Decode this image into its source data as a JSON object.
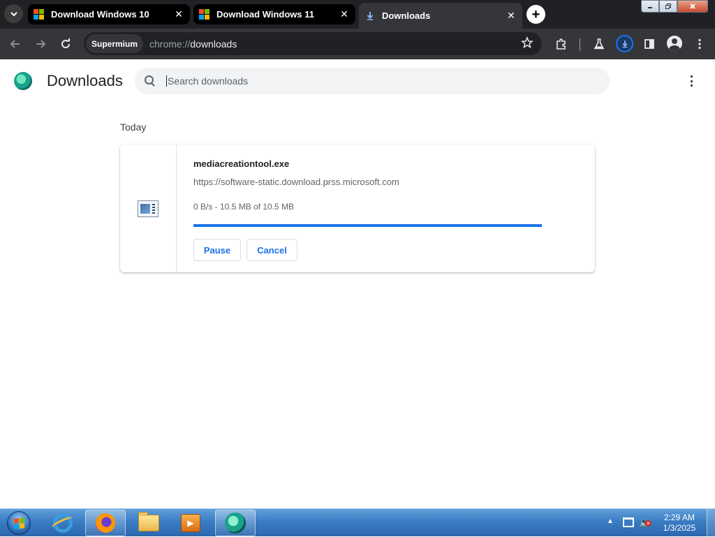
{
  "browser": {
    "tabs": [
      {
        "label": "Download Windows 10",
        "favicon": "microsoft-logo-icon",
        "active": false
      },
      {
        "label": "Download Windows 11",
        "favicon": "microsoft-logo-icon",
        "active": false
      },
      {
        "label": "Downloads",
        "favicon": "download-icon",
        "active": true
      }
    ],
    "tab_close_glyph": "✕",
    "new_tab_glyph": "+",
    "address_chip": "Supermium",
    "url_scheme": "chrome://",
    "url_host": "downloads",
    "accent": "#1a73e8"
  },
  "page": {
    "title": "Downloads",
    "search_placeholder": "Search downloads",
    "date_header": "Today",
    "download": {
      "file_name": "mediacreationtool.exe",
      "source_url": "https://software-static.download.prss.microsoft.com",
      "status": "0 B/s - 10.5 MB of 10.5 MB",
      "progress_percent": 100,
      "pause_label": "Pause",
      "cancel_label": "Cancel"
    }
  },
  "taskbar": {
    "pinned": [
      "internet-explorer-icon",
      "firefox-icon",
      "file-explorer-icon",
      "media-player-icon",
      "supermium-icon"
    ],
    "clock_time": "2:29 AM",
    "clock_date": "1/3/2025"
  }
}
